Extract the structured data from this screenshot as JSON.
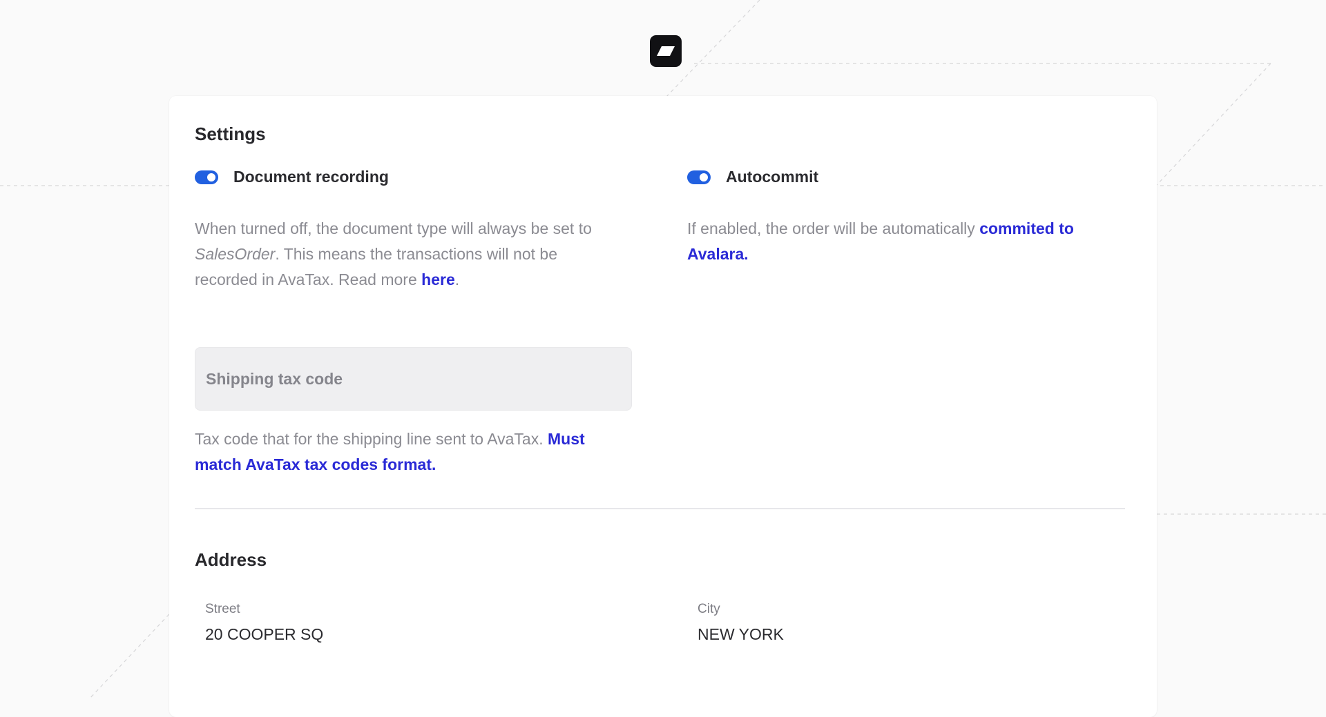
{
  "settings": {
    "title": "Settings",
    "document_recording": {
      "label": "Document recording",
      "enabled": true,
      "desc_part1": "When turned off, the document type will always be set to",
      "desc_italic": "SalesOrder",
      "desc_part2": ". This means the transactions will not be",
      "desc_part3": "recorded in AvaTax. Read more ",
      "desc_link": "here",
      "desc_end": "."
    },
    "autocommit": {
      "label": "Autocommit",
      "enabled": true,
      "desc_text": "If enabled, the order will be automatically ",
      "desc_link_line1": "commited to",
      "desc_link_line2": "Avalara."
    },
    "shipping_tax_code": {
      "placeholder": "Shipping tax code",
      "value": "",
      "help_text": "Tax code that for the shipping line sent to AvaTax. ",
      "help_link_line1": "Must",
      "help_link_line2": "match AvaTax tax codes format."
    }
  },
  "address": {
    "title": "Address",
    "street_label": "Street",
    "street_value": "20 COOPER SQ",
    "city_label": "City",
    "city_value": "NEW YORK"
  },
  "colors": {
    "accent": "#2160e0",
    "link": "#2a2ad6",
    "background": "#fafafa"
  }
}
